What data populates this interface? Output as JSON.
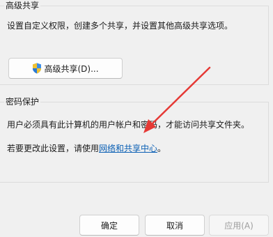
{
  "advanced_sharing": {
    "group_title": "高级共享",
    "description": "设置自定义权限，创建多个共享，并设置其他高级共享选项。",
    "button_label": "高级共享(D)...",
    "button_icon": "uac-shield-icon"
  },
  "password_protection": {
    "group_title": "密码保护",
    "description": "用户必须具有此计算机的用户帐户和密码，才能访问共享文件夹。",
    "change_prefix": "若要更改此设置，请使用",
    "change_link": "网络和共享中心",
    "change_suffix": "。"
  },
  "footer": {
    "ok_label": "确定",
    "cancel_label": "取消",
    "apply_label": "应用(A)"
  },
  "colors": {
    "link": "#0a5fb4",
    "arrow": "#e53935",
    "dialog_background": "#f0f0f0"
  }
}
